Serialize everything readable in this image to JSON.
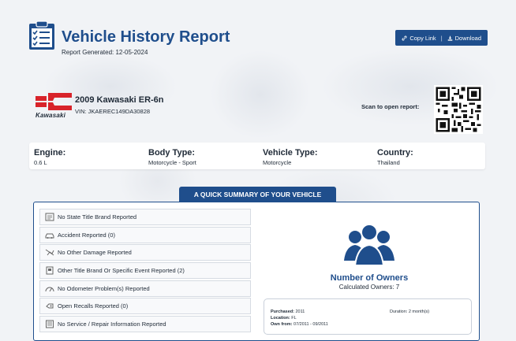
{
  "header": {
    "title": "Vehicle History Report",
    "generated": "Report Generated: 12-05-2024",
    "copy_link_label": "Copy Link",
    "separator": "|",
    "download_label": "Download"
  },
  "vehicle": {
    "brand_logo_text": "Kawasaki",
    "name": "2009 Kawasaki ER-6n",
    "vin": "VIN: JKAEREC149DA30828",
    "scan_label": "Scan to open report:"
  },
  "specs": [
    {
      "label": "Engine:",
      "value": "0.6 L"
    },
    {
      "label": "Body Type:",
      "value": "Motorcycle - Sport"
    },
    {
      "label": "Vehicle Type:",
      "value": "Motorcycle"
    },
    {
      "label": "Country:",
      "value": "Thailand"
    }
  ],
  "summary": {
    "tab_title": "A QUICK SUMMARY OF YOUR VEHICLE",
    "items": [
      {
        "label": "No State Title Brand Reported",
        "icon": "title-brand-icon"
      },
      {
        "label": "Accident Reported (0)",
        "icon": "accident-car-icon"
      },
      {
        "label": "No Other Damage Reported",
        "icon": "damage-icon"
      },
      {
        "label": "Other Title Brand Or Specific Event Reported (2)",
        "icon": "document-icon"
      },
      {
        "label": "No Odometer Problem(s) Reported",
        "icon": "odometer-icon"
      },
      {
        "label": "Open Recalls Reported (0)",
        "icon": "recall-icon"
      },
      {
        "label": "No Service / Repair Information Reported",
        "icon": "service-icon"
      }
    ],
    "owners_title": "Number of Owners",
    "owners_count": "Calculated Owners: 7",
    "owner_card": {
      "purchased_label": "Purchased:",
      "purchased_value": "2011",
      "location_label": "Location:",
      "location_value": "FL",
      "own_from_label": "Own from:",
      "own_from_value": "07/2011 - 09/2011",
      "duration": "Duration: 2 month(s)"
    }
  },
  "colors": {
    "accent": "#1f4e8c",
    "logo_red": "#d8232a"
  }
}
